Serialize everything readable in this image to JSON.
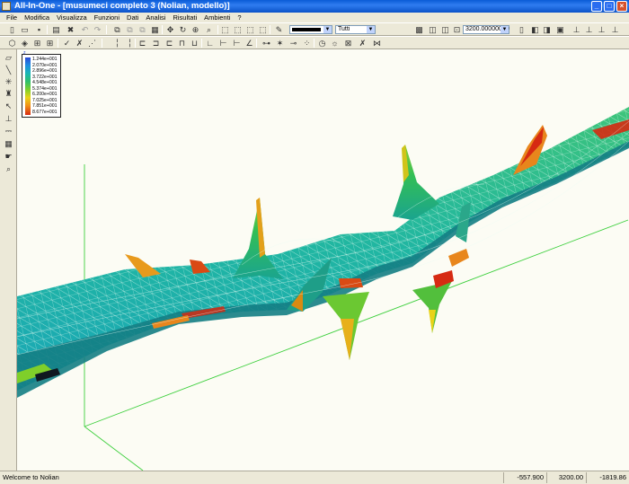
{
  "window": {
    "title": "All-In-One - [musumeci completo 3 (Nolian, modello)]",
    "controls": [
      "_",
      "□",
      "×"
    ]
  },
  "menu": [
    "File",
    "Modifica",
    "Visualizza",
    "Funzioni",
    "Dati",
    "Analisi",
    "Risultati",
    "Ambienti",
    "?"
  ],
  "toolbar": {
    "color_label": "",
    "layer_label": "Tutti",
    "zoom_value": "3200.00000000"
  },
  "legend": {
    "values": [
      "1.244e+001",
      "2.070e+001",
      "2.896e+001",
      "3.722e+001",
      "4.548e+001",
      "5.374e+001",
      "6.200e+001",
      "7.025e+001",
      "7.851e+001",
      "8.677e+001"
    ]
  },
  "gizmo": {
    "x": "x",
    "y": "y",
    "z": "z"
  },
  "status": {
    "message": "Welcome to Nolian",
    "x": "-557.900",
    "y": "3200.00",
    "z": "-1819.86"
  },
  "colors": {
    "titlebar": "#0a5bd6",
    "viewport_bg": "#fcfcf4",
    "mesh_green": "#2fbf6a",
    "mesh_cyan": "#1ab6b4",
    "hot_red": "#d62a12",
    "grid_line": "#3ccf3c"
  }
}
